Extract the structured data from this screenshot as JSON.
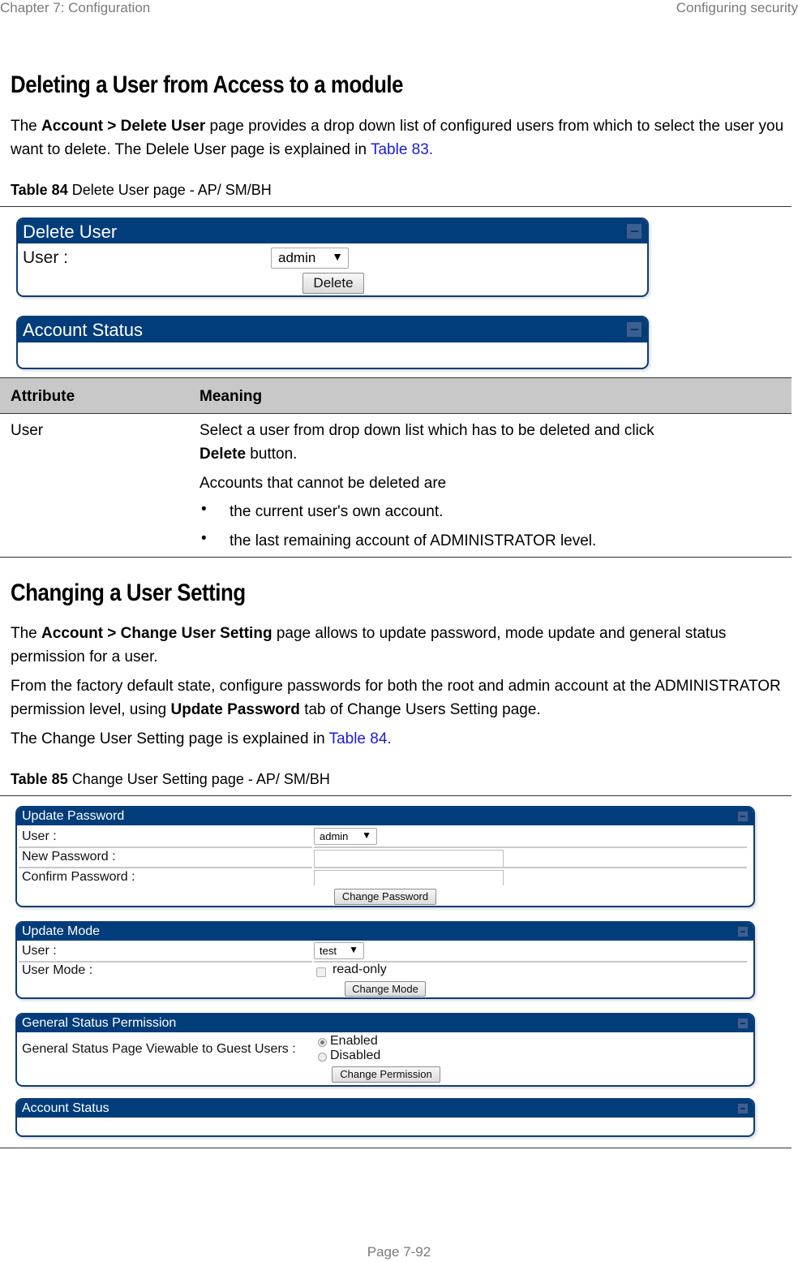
{
  "header": {
    "chapter": "Chapter 7:  Configuration",
    "section": "Configuring security"
  },
  "section1": {
    "heading": "Deleting a User from Access to a module",
    "intro": {
      "pre": "The ",
      "bold": "Account > Delete User",
      "post": " page provides a drop down list of configured users from which to select the user you want to delete. The Delele User page is explained in ",
      "link": "Table 83."
    },
    "caption": {
      "label": "Table 84",
      "text": "  Delete User page - AP/ SM/BH"
    },
    "ui": {
      "delete_panel": {
        "title": "Delete User",
        "user_label": "User :",
        "user_select": "admin",
        "arrow": "▼",
        "delete_button": "Delete"
      },
      "status_panel": {
        "title": "Account Status"
      }
    },
    "table": {
      "headers": [
        "Attribute",
        "Meaning"
      ],
      "rows": [
        {
          "attribute": "User",
          "meaning_line1": "Select a user from drop down list which has to be deleted and click",
          "meaning_bold": "Delete",
          "meaning_line2_rest": " button.",
          "meaning_line3": "Accounts that cannot be deleted are",
          "bullets": [
            "the current user's own account.",
            "the last remaining account of ADMINISTRATOR level."
          ]
        }
      ]
    }
  },
  "section2": {
    "heading": "Changing a User Setting",
    "p1": {
      "pre": "The ",
      "bold": "Account > Change User Setting",
      "post": " page allows to update password, mode update and general status permission for a user."
    },
    "p2": {
      "pre": "From the factory default state, configure passwords for both the root and admin account at the ADMINISTRATOR permission level, using ",
      "bold": "Update Password",
      "post": " tab of Change Users Setting page."
    },
    "p3": {
      "pre": "The Change User Setting page is explained in ",
      "link": "Table 84."
    },
    "caption": {
      "label": "Table 85",
      "text": "  Change User Setting page - AP/ SM/BH"
    },
    "ui": {
      "update_password": {
        "title": "Update Password",
        "user_label": "User :",
        "user_select": "admin",
        "new_password_label": "New Password :",
        "new_password_value": "",
        "confirm_password_label": "Confirm Password :",
        "confirm_password_value": "",
        "button": "Change Password"
      },
      "update_mode": {
        "title": "Update Mode",
        "user_label": "User :",
        "user_select": "test",
        "mode_label": "User Mode :",
        "checkbox_label": "read-only",
        "checkbox_checked": false,
        "button": "Change Mode"
      },
      "general_status": {
        "title": "General Status Permission",
        "label": "General Status Page Viewable to Guest Users :",
        "options": [
          "Enabled",
          "Disabled"
        ],
        "selected": "Enabled",
        "button": "Change Permission"
      },
      "account_status": {
        "title": "Account Status"
      },
      "arrow": "▼"
    }
  },
  "footer": {
    "page": "Page 7-92"
  }
}
